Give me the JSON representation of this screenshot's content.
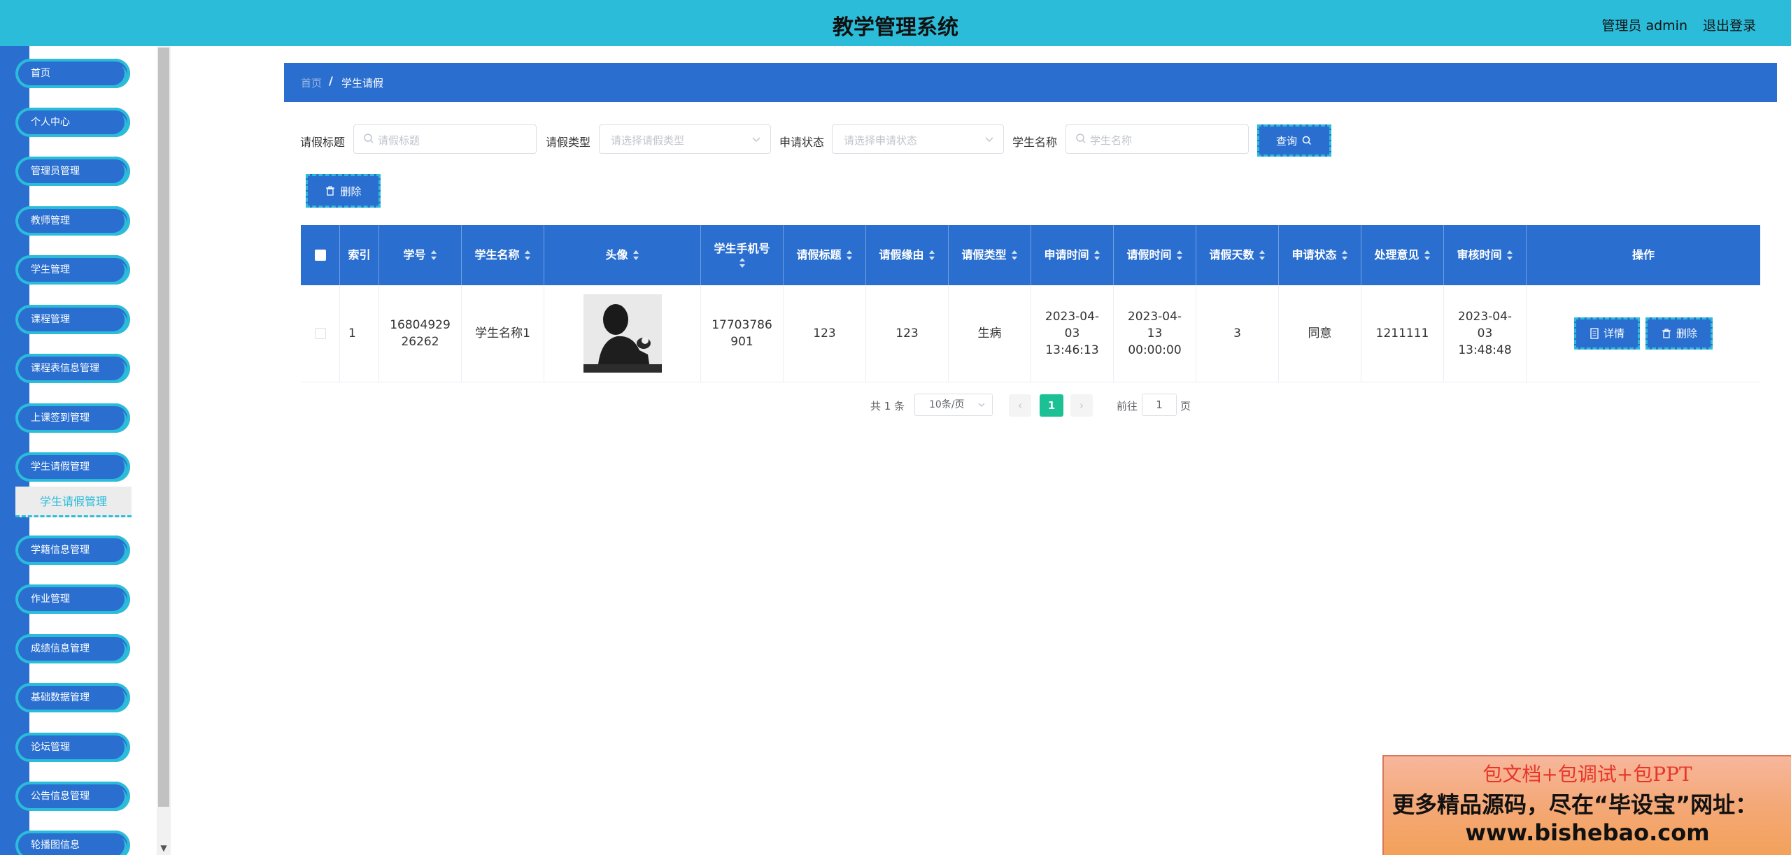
{
  "header": {
    "title": "教学管理系统",
    "user": "管理员 admin",
    "logout": "退出登录"
  },
  "sidebar": {
    "items": [
      {
        "label": "首页"
      },
      {
        "label": "个人中心"
      },
      {
        "label": "管理员管理"
      },
      {
        "label": "教师管理"
      },
      {
        "label": "学生管理"
      },
      {
        "label": "课程管理"
      },
      {
        "label": "课程表信息管理"
      },
      {
        "label": "上课签到管理"
      },
      {
        "label": "学生请假管理"
      },
      {
        "label": "学籍信息管理"
      },
      {
        "label": "作业管理"
      },
      {
        "label": "成绩信息管理"
      },
      {
        "label": "基础数据管理"
      },
      {
        "label": "论坛管理"
      },
      {
        "label": "公告信息管理"
      },
      {
        "label": "轮播图信息"
      }
    ],
    "active_sub": "学生请假管理"
  },
  "breadcrumb": {
    "home": "首页",
    "sep": "/",
    "current": "学生请假"
  },
  "search": {
    "title_label": "请假标题",
    "title_placeholder": "请假标题",
    "type_label": "请假类型",
    "type_placeholder": "请选择请假类型",
    "status_label": "申请状态",
    "status_placeholder": "请选择申请状态",
    "name_label": "学生名称",
    "name_placeholder": "学生名称",
    "query_button": "查询"
  },
  "toolbar": {
    "delete_label": "删除"
  },
  "table": {
    "headers": {
      "index": "索引",
      "student_no": "学号",
      "student_name": "学生名称",
      "avatar": "头像",
      "phone": "学生手机号",
      "leave_title": "请假标题",
      "leave_reason": "请假缘由",
      "leave_type": "请假类型",
      "apply_time": "申请时间",
      "leave_time": "请假时间",
      "days": "请假天数",
      "status": "申请状态",
      "opinion": "处理意见",
      "review_time": "审核时间",
      "actions": "操作"
    },
    "rows": [
      {
        "index": "1",
        "student_no": "1680492926262",
        "student_name": "学生名称1",
        "phone": "17703786901",
        "leave_title": "123",
        "leave_reason": "123",
        "leave_type": "生病",
        "apply_time": "2023-04-03 13:46:13",
        "leave_time": "2023-04-13 00:00:00",
        "days": "3",
        "status": "同意",
        "opinion": "1211111",
        "review_time": "2023-04-03 13:48:48",
        "detail_label": "详情",
        "delete_label": "删除"
      }
    ]
  },
  "pagination": {
    "total": "共 1 条",
    "page_size": "10条/页",
    "prev": "‹",
    "current": "1",
    "next": "›",
    "goto": "前往",
    "goto_value": "1",
    "page_suffix": "页"
  },
  "ad": {
    "line1": "包文档+包调试+包PPT",
    "line2": "更多精品源码，尽在“毕设宝”网址：",
    "line3": "www.bishebao.com"
  },
  "colors": {
    "header": "#2bbcd9",
    "primary": "#2a6fd0",
    "accent": "#2bbcd9",
    "page_active": "#1bc094"
  }
}
